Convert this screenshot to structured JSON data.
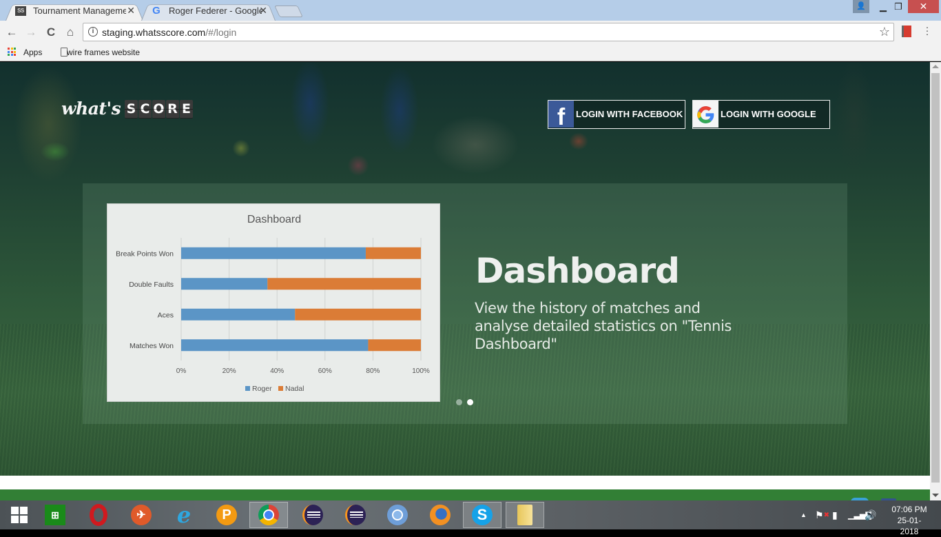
{
  "browser": {
    "tabs": [
      {
        "favicon": "SS",
        "title": "Tournament Management",
        "active": true
      },
      {
        "favicon": "G",
        "title": "Roger Federer - Google Search",
        "active": false
      }
    ],
    "window_controls": {
      "user": "user-icon",
      "minimize": "minimize-icon",
      "maximize": "restore-icon",
      "close": "close-icon"
    },
    "nav": {
      "back": "←",
      "forward": "→",
      "reload": "C",
      "home": "⌂"
    },
    "url": {
      "host": "staging.whatsscore.com",
      "path": "/#/login"
    },
    "bookmarks": [
      {
        "icon": "apps-grid-icon",
        "label": "Apps"
      },
      {
        "icon": "page-icon",
        "label": "wire frames website"
      }
    ]
  },
  "site": {
    "logo": {
      "script": "what's",
      "tiles": [
        "S",
        "C",
        "O",
        "R",
        "E"
      ]
    },
    "login_buttons": [
      {
        "provider": "facebook",
        "label": "LOGIN WITH FACEBOOK",
        "color": "#3b5998"
      },
      {
        "provider": "google",
        "label": "LOGIN WITH GOOGLE"
      }
    ],
    "slide": {
      "title": "Dashboard",
      "text": "View the history of matches and analyse detailed statistics on \"Tennis Dashboard\"",
      "dots": [
        {
          "active": false
        },
        {
          "active": true
        }
      ]
    }
  },
  "chart_data": {
    "type": "bar",
    "orientation": "horizontal",
    "stacked": "100%",
    "title": "Dashboard",
    "categories": [
      "Break Points Won",
      "Double Faults",
      "Aces",
      "Matches Won"
    ],
    "series": [
      {
        "name": "Roger",
        "color": "#5b95c6",
        "values": [
          77,
          36,
          47.5,
          78
        ]
      },
      {
        "name": "Nadal",
        "color": "#db7c36",
        "values": [
          23,
          64,
          52.5,
          22
        ]
      }
    ],
    "xlim": [
      0,
      100
    ],
    "xticks": [
      "0%",
      "20%",
      "40%",
      "60%",
      "80%",
      "100%"
    ],
    "xlabel": "",
    "ylabel": "",
    "grid": true,
    "legend": "bottom"
  },
  "taskbar": {
    "items": [
      {
        "name": "start",
        "open": false
      },
      {
        "name": "store",
        "open": false
      },
      {
        "name": "opera",
        "open": false
      },
      {
        "name": "rocket-app",
        "open": false
      },
      {
        "name": "internet-explorer",
        "open": false
      },
      {
        "name": "pdf-app",
        "open": false
      },
      {
        "name": "chrome",
        "open": true
      },
      {
        "name": "eclipse",
        "open": false
      },
      {
        "name": "eclipse-2",
        "open": false
      },
      {
        "name": "chromium",
        "open": false
      },
      {
        "name": "firefox",
        "open": false
      },
      {
        "name": "skype",
        "open": true
      },
      {
        "name": "file-explorer",
        "open": true
      }
    ],
    "clock": {
      "time": "07:06 PM",
      "date": "25-01-2018"
    }
  }
}
